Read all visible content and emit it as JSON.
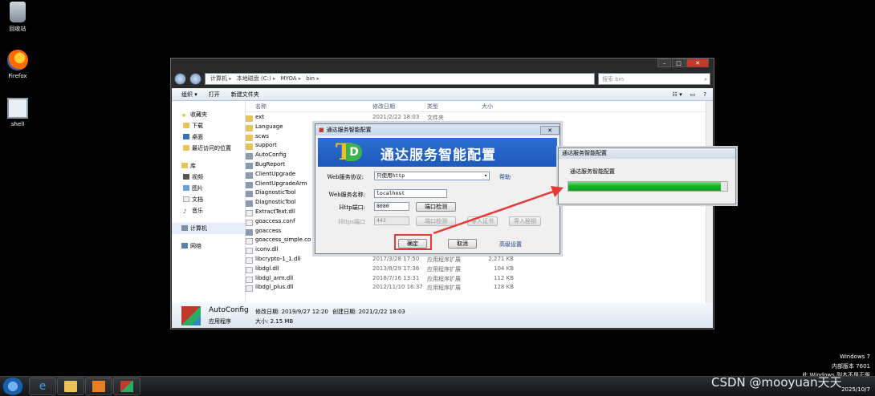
{
  "desktop": {
    "icons": [
      {
        "label": "回收站"
      },
      {
        "label": "Firefox"
      },
      {
        "label": "shell"
      }
    ],
    "os_info": [
      "Windows 7",
      "内部版本 7601",
      "此 Windows 副本不是正版"
    ],
    "clock_date": "2025/10/7"
  },
  "explorer": {
    "breadcrumbs": [
      "计算机",
      "本地磁盘 (C:)",
      "MYOA",
      "bin"
    ],
    "search_placeholder": "搜索 bin",
    "toolbar": {
      "organize": "组织 ▾",
      "open": "打开",
      "new_folder": "新建文件夹"
    },
    "nav": {
      "favorites": "收藏夹",
      "fav_items": [
        "下载",
        "桌面",
        "最近访问的位置"
      ],
      "libraries": "库",
      "lib_items": [
        "视频",
        "图片",
        "文档",
        "音乐"
      ],
      "computer": "计算机",
      "network": "网络"
    },
    "columns": {
      "name": "名称",
      "date": "修改日期",
      "type": "类型",
      "size": "大小"
    },
    "files": [
      {
        "name": "ext",
        "date": "2021/2/22 18:03",
        "type": "文件夹",
        "size": "",
        "kind": "folder"
      },
      {
        "name": "Language",
        "date": "",
        "type": "",
        "size": "",
        "kind": "folder"
      },
      {
        "name": "scws",
        "date": "",
        "type": "",
        "size": "",
        "kind": "folder"
      },
      {
        "name": "support",
        "date": "",
        "type": "",
        "size": "",
        "kind": "folder"
      },
      {
        "name": "AutoConfig",
        "date": "",
        "type": "",
        "size": "",
        "kind": "app"
      },
      {
        "name": "BugReport",
        "date": "",
        "type": "",
        "size": "",
        "kind": "app"
      },
      {
        "name": "ClientUpgrade",
        "date": "",
        "type": "",
        "size": "",
        "kind": "app"
      },
      {
        "name": "ClientUpgradeArm",
        "date": "",
        "type": "",
        "size": "",
        "kind": "app"
      },
      {
        "name": "DiagnosticTool",
        "date": "",
        "type": "",
        "size": "",
        "kind": "app"
      },
      {
        "name": "DiagnosticTool",
        "date": "",
        "type": "",
        "size": "",
        "kind": "app"
      },
      {
        "name": "ExtractText.dll",
        "date": "",
        "type": "",
        "size": "",
        "kind": "dll"
      },
      {
        "name": "goaccess.conf",
        "date": "",
        "type": "",
        "size": "",
        "kind": "dll"
      },
      {
        "name": "goaccess",
        "date": "",
        "type": "",
        "size": "",
        "kind": "app"
      },
      {
        "name": "goaccess_simple.co",
        "date": "",
        "type": "",
        "size": "",
        "kind": "dll"
      },
      {
        "name": "iconv.dll",
        "date": "2004/1/14 1:56",
        "type": "应用程序扩展",
        "size": "872 KB",
        "kind": "dll"
      },
      {
        "name": "libcrypto-1_1.dll",
        "date": "2017/3/28 17:50",
        "type": "应用程序扩展",
        "size": "2,271 KB",
        "kind": "dll"
      },
      {
        "name": "libdgl.dll",
        "date": "2013/8/29 17:36",
        "type": "应用程序扩展",
        "size": "104 KB",
        "kind": "dll"
      },
      {
        "name": "libdgl_arm.dll",
        "date": "2018/7/16 13:31",
        "type": "应用程序扩展",
        "size": "112 KB",
        "kind": "dll"
      },
      {
        "name": "libdgl_plus.dll",
        "date": "2012/11/10 16:37",
        "type": "应用程序扩展",
        "size": "128 KB",
        "kind": "dll"
      }
    ],
    "details": {
      "name": "AutoConfig",
      "kind": "应用程序",
      "modified": "修改日期: 2019/9/27 12:20",
      "created": "创建日期: 2021/2/22 18:03",
      "size": "大小: 2.15 MB"
    }
  },
  "config_dialog": {
    "title": "通达服务智能配置",
    "banner_text": "通达服务智能配置",
    "logo_letters": [
      "T",
      "D"
    ],
    "protocol_label": "Web服务协议:",
    "protocol_value": "只使用http",
    "help": "帮助",
    "server_name_label": "Web服务名称:",
    "server_name_value": "localhost",
    "http_port_label": "Http端口:",
    "http_port_value": "8080",
    "port_check": "端口检测",
    "https_port_label": "Https端口",
    "https_port_value": "443",
    "https_port_check": "端口检测",
    "import_cert": "导入证书",
    "import_key": "导入秘钥",
    "ok": "确定",
    "cancel": "取消",
    "advanced": "高级设置"
  },
  "progress_dialog": {
    "title": "通达服务智能配置",
    "message": "通达服务智能配置",
    "progress": 0.96
  },
  "watermark": "CSDN @mooyuan天天",
  "colors": {
    "highlight": "#e53935",
    "banner": "#1e58bb",
    "progress": "#17b52a"
  }
}
